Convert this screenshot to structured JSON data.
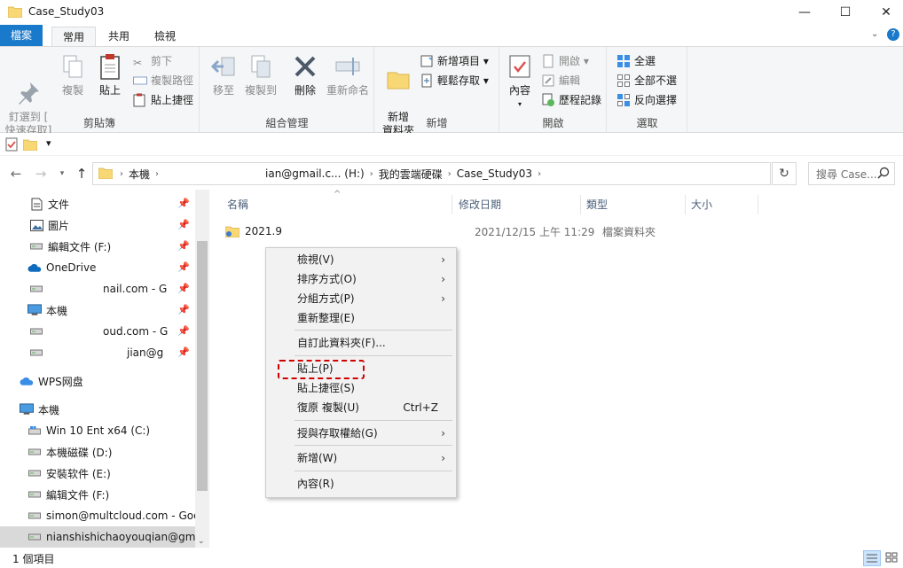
{
  "window": {
    "title": "Case_Study03",
    "minimize": "—",
    "maximize": "☐",
    "close": "✕"
  },
  "ribbon_tabs": [
    "檔案",
    "常用",
    "共用",
    "檢視"
  ],
  "ribbon": {
    "clipboard": {
      "label": "剪貼簿",
      "pin": "釘選到 [\n快速存取]",
      "copy": "複製",
      "paste": "貼上",
      "cut": "剪下",
      "copy_path": "複製路徑",
      "paste_shortcut": "貼上捷徑"
    },
    "organize": {
      "label": "組合管理",
      "move_to": "移至",
      "copy_to": "複製到",
      "delete": "刪除",
      "rename": "重新命名"
    },
    "new": {
      "label": "新增",
      "new_folder": "新增\n資料夾",
      "new_item": "新增項目 ▾",
      "easy_access": "輕鬆存取 ▾"
    },
    "open": {
      "label": "開啟",
      "properties": "內容",
      "open": "開啟 ▾",
      "edit": "編輯",
      "history": "歷程記錄"
    },
    "select": {
      "label": "選取",
      "select_all": "全選",
      "select_none": "全部不選",
      "invert": "反向選擇"
    }
  },
  "address": {
    "segments": [
      "本機",
      "ian@gmail.c... (H:)",
      "我的雲端硬碟",
      "Case_Study03"
    ],
    "search_placeholder": "搜尋 Case..."
  },
  "nav_pane": [
    {
      "label": "文件",
      "icon": "document-icon",
      "pinned": true
    },
    {
      "label": "圖片",
      "icon": "picture-icon",
      "pinned": true
    },
    {
      "label": "編輯文件 (F:)",
      "icon": "drive-icon",
      "pinned": true
    },
    {
      "label": "OneDrive",
      "icon": "onedrive-icon",
      "pinned": true
    },
    {
      "label": "nail.com - G",
      "icon": "drive-icon",
      "pinned": true
    },
    {
      "label": "本機",
      "icon": "computer-icon",
      "pinned": true
    },
    {
      "label": "oud.com - G",
      "icon": "drive-icon",
      "pinned": true
    },
    {
      "label": "jian@g",
      "icon": "drive-icon",
      "pinned": true
    },
    {
      "label": "WPS网盘",
      "icon": "cloud-icon",
      "pinned": false
    },
    {
      "label": "本機",
      "icon": "computer-icon",
      "pinned": false
    },
    {
      "label": "Win 10 Ent x64 (C:)",
      "icon": "windows-drive-icon",
      "pinned": false
    },
    {
      "label": "本機磁碟 (D:)",
      "icon": "drive-icon",
      "pinned": false
    },
    {
      "label": "安裝软件 (E:)",
      "icon": "drive-icon",
      "pinned": false
    },
    {
      "label": "編辑文件 (F:)",
      "icon": "drive-icon",
      "pinned": false
    },
    {
      "label": "simon@multcloud.com - Goo",
      "icon": "drive-icon",
      "pinned": false
    },
    {
      "label": "nianshishichaoyouqian@gma",
      "icon": "drive-icon",
      "pinned": false
    }
  ],
  "columns": [
    "名稱",
    "修改日期",
    "類型",
    "大小"
  ],
  "files": [
    {
      "name": "2021.9",
      "modified": "2021/12/15 上午 11:29",
      "type": "檔案資料夾"
    }
  ],
  "context_menu": [
    {
      "label": "檢視(V)",
      "submenu": true
    },
    {
      "label": "排序方式(O)",
      "submenu": true
    },
    {
      "label": "分組方式(P)",
      "submenu": true
    },
    {
      "label": "重新整理(E)",
      "submenu": false
    },
    {
      "label": "自訂此資料夾(F)...",
      "submenu": false
    },
    {
      "label": "貼上(P)",
      "submenu": false
    },
    {
      "label": "貼上捷徑(S)",
      "submenu": false
    },
    {
      "label": "復原 複製(U)",
      "submenu": false,
      "shortcut": "Ctrl+Z"
    },
    {
      "label": "授與存取權給(G)",
      "submenu": true
    },
    {
      "label": "新增(W)",
      "submenu": true
    },
    {
      "label": "內容(R)",
      "submenu": false
    }
  ],
  "status": {
    "count": "1 個項目"
  },
  "colors": {
    "file_tab": "#1979ca",
    "highlight_border": "#d10000",
    "folder_yellow": "#f8d775"
  }
}
